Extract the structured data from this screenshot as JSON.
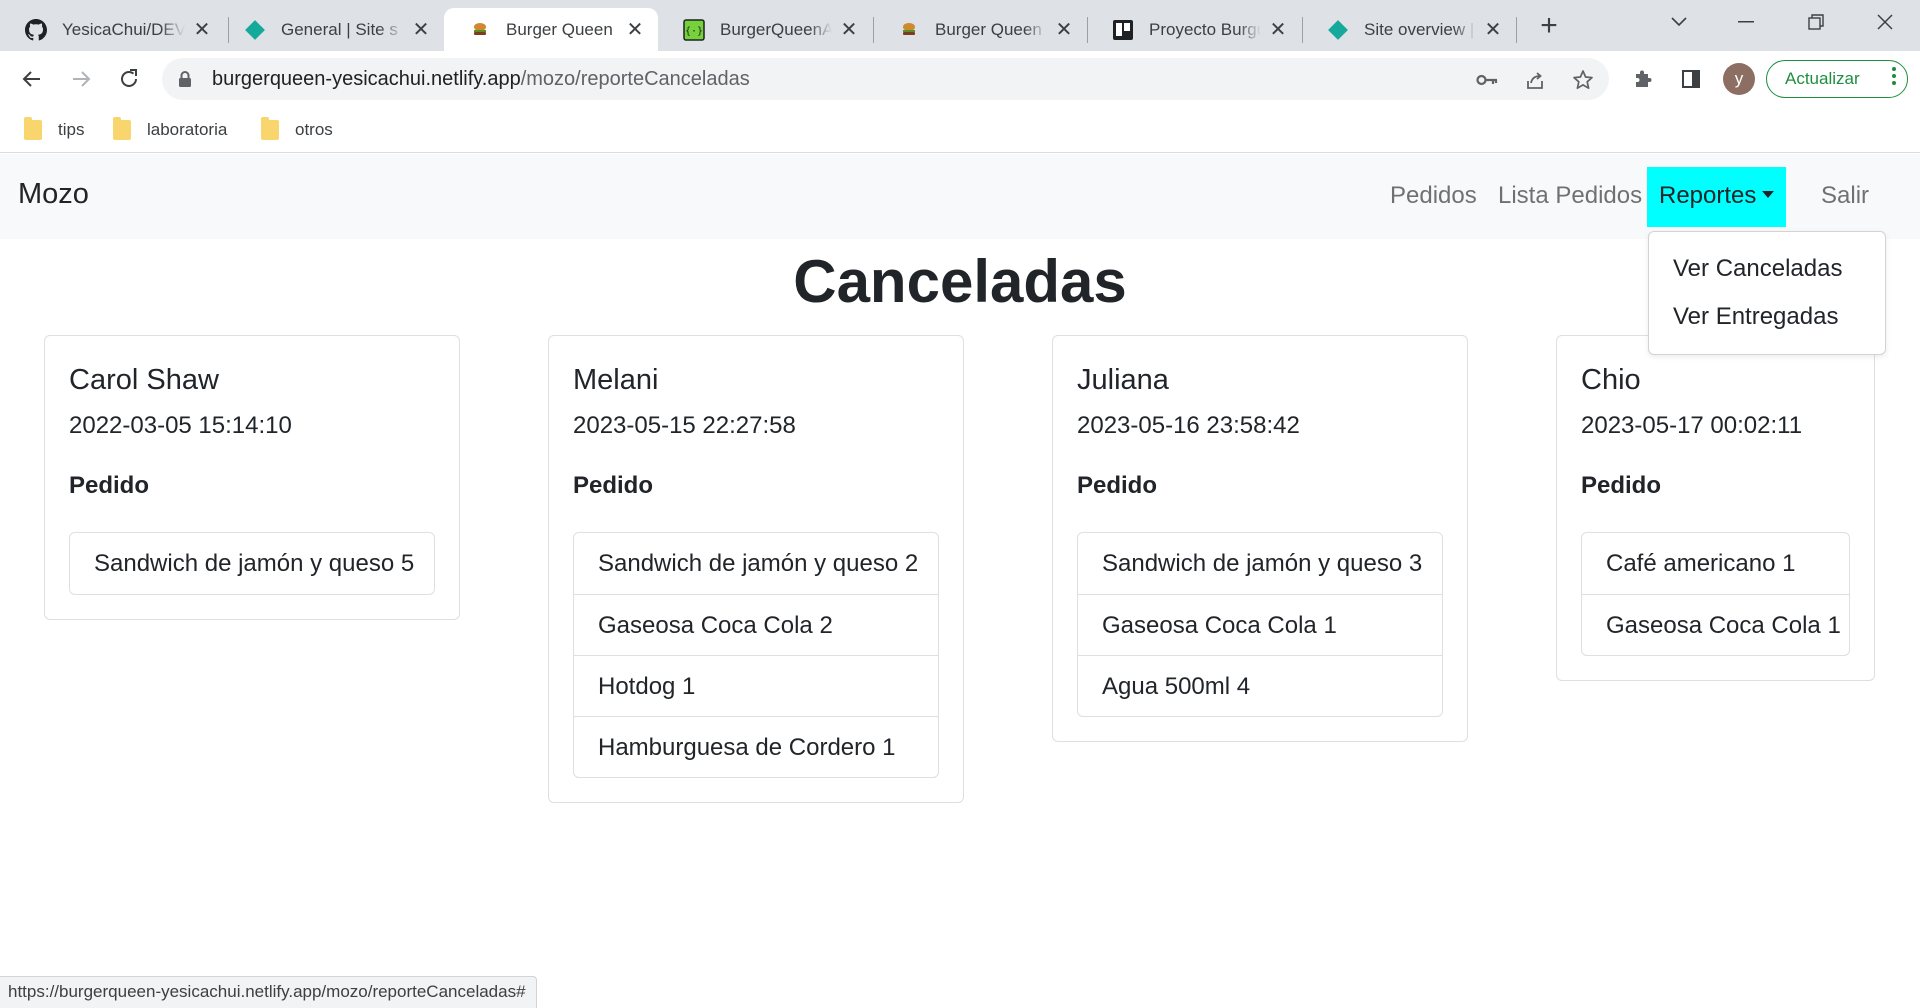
{
  "browser": {
    "tabs": [
      {
        "title": "YesicaChui/DEV",
        "icon": "github-icon"
      },
      {
        "title": "General | Site s",
        "icon": "netlify-icon"
      },
      {
        "title": "Burger Queen",
        "icon": "burger-icon",
        "active": true
      },
      {
        "title": "BurgerQueenA",
        "icon": "json-server-icon"
      },
      {
        "title": "Burger Queen",
        "icon": "burger-icon"
      },
      {
        "title": "Proyecto Burgu",
        "icon": "trello-icon"
      },
      {
        "title": "Site overview |",
        "icon": "netlify-icon"
      }
    ],
    "url_host": "burgerqueen-yesicachui.netlify.app",
    "url_path": "/mozo/reporteCanceladas",
    "avatar_letter": "y",
    "update_label": "Actualizar",
    "bookmarks": [
      "tips",
      "laboratoria",
      "otros"
    ],
    "status_url": "https://burgerqueen-yesicachui.netlify.app/mozo/reporteCanceladas#"
  },
  "colors": {
    "dropdown_active_bg": "#00ffff",
    "navbar_bg": "#f8f9fa",
    "update_green": "#1e8e3e"
  },
  "navbar": {
    "brand": "Mozo",
    "links": {
      "pedidos": "Pedidos",
      "lista_pedidos": "Lista Pedidos",
      "reportes": "Reportes",
      "salir": "Salir"
    },
    "dropdown": [
      "Ver Canceladas",
      "Ver Entregadas"
    ]
  },
  "page": {
    "title": "Canceladas",
    "order_label": "Pedido"
  },
  "cards": [
    {
      "name": "Carol Shaw",
      "date": "2022-03-05 15:14:10",
      "items": [
        "Sandwich de jamón y queso 5"
      ]
    },
    {
      "name": "Melani",
      "date": "2023-05-15 22:27:58",
      "items": [
        "Sandwich de jamón y queso 2",
        "Gaseosa Coca Cola 2",
        "Hotdog 1",
        "Hamburguesa de Cordero 1"
      ]
    },
    {
      "name": "Juliana",
      "date": "2023-05-16 23:58:42",
      "items": [
        "Sandwich de jamón y queso 3",
        "Gaseosa Coca Cola 1",
        "Agua 500ml 4"
      ]
    },
    {
      "name": "Chio",
      "date": "2023-05-17 00:02:11",
      "items": [
        "Café americano 1",
        "Gaseosa Coca Cola 1"
      ]
    }
  ]
}
